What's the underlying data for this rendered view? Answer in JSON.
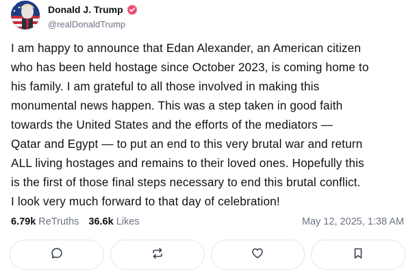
{
  "author": {
    "display_name": "Donald J. Trump",
    "handle": "@realDonaldTrump",
    "verified_color": "#e84a6f"
  },
  "post": {
    "lines": [
      "I am happy to announce that Edan Alexander, an American citizen",
      "who has been held hostage since October 2023, is coming home to",
      "his family. I am grateful to all those involved in making this",
      "monumental news happen. This was a step taken in good faith",
      "towards the United States and the efforts of the mediators —",
      "Qatar and Egypt — to put an end to this very brutal war and return",
      "ALL living hostages and remains to their loved ones. Hopefully this",
      "is the first of those final steps necessary to end this brutal conflict.",
      "I look very much forward to that day of celebration!"
    ]
  },
  "stats": {
    "retruths_count": "6.79k",
    "retruths_label": "ReTruths",
    "likes_count": "36.6k",
    "likes_label": "Likes",
    "timestamp": "May 12, 2025, 1:38 AM"
  },
  "actions": [
    {
      "icon": "reply-icon"
    },
    {
      "icon": "retruth-icon"
    },
    {
      "icon": "like-icon"
    },
    {
      "icon": "bookmark-icon"
    }
  ],
  "colors": {
    "text": "#111111",
    "muted": "#6b7280",
    "border": "#e2e4e8"
  }
}
